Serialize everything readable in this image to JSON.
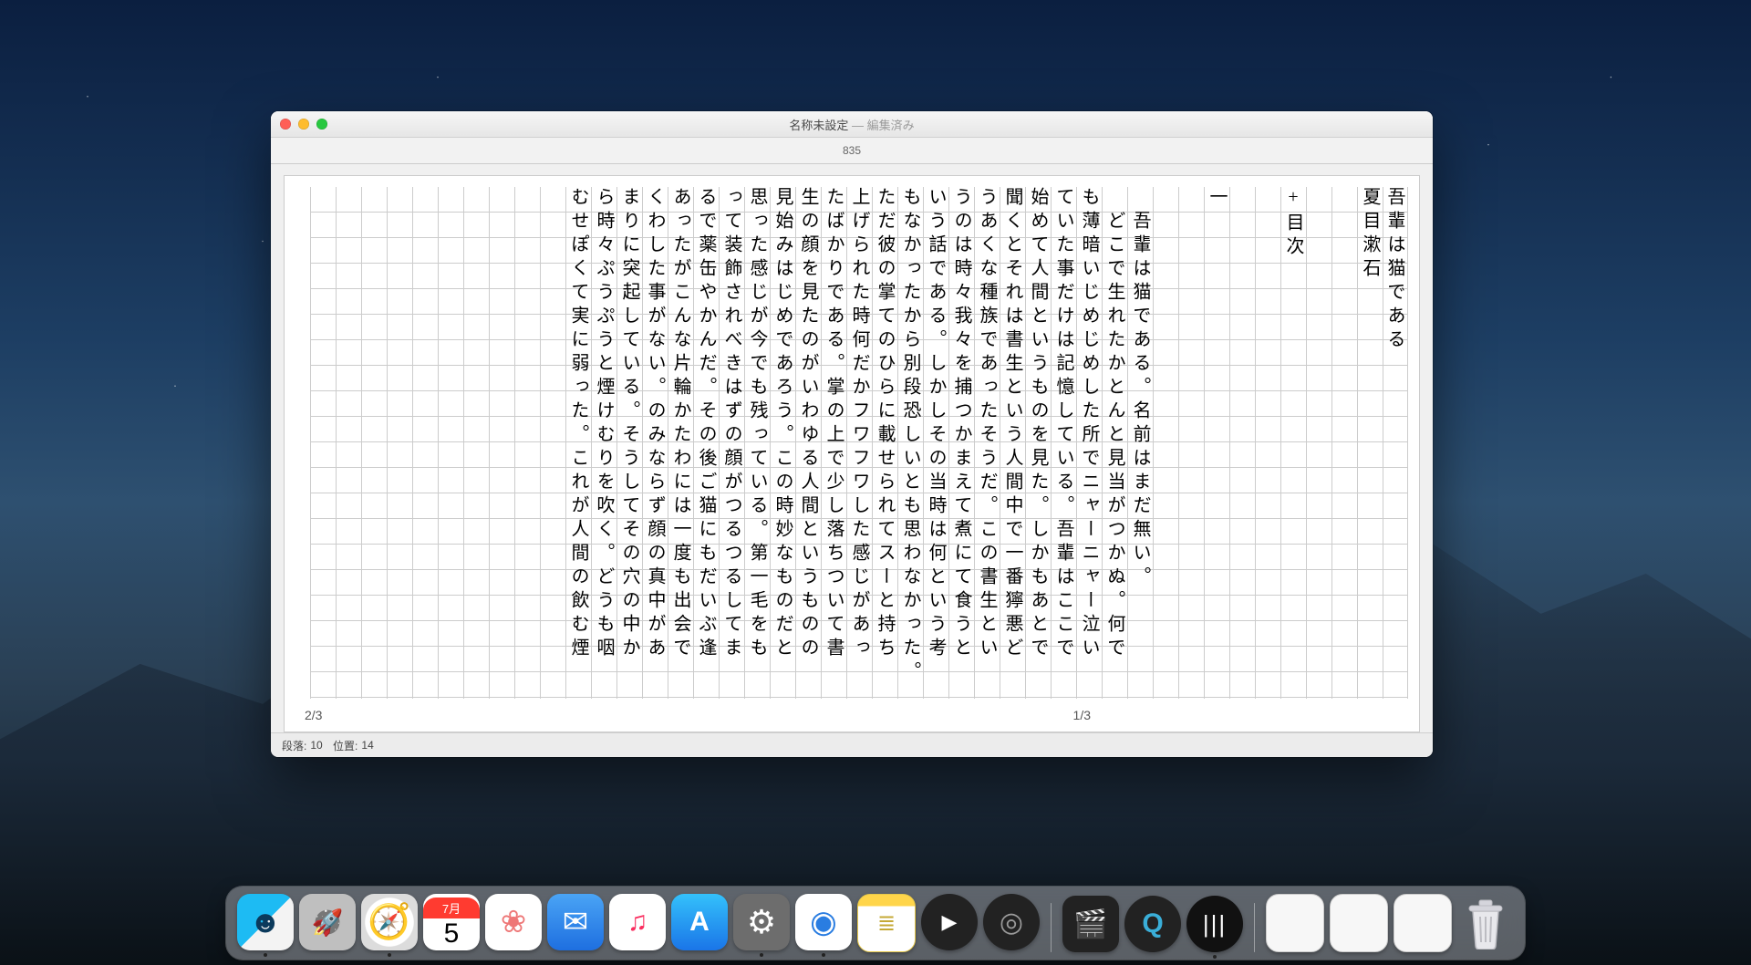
{
  "window": {
    "title": "名称未設定",
    "title_suffix": "— 編集済み",
    "ruler_value": "835",
    "page_left": "2/3",
    "page_right": "1/3"
  },
  "status": {
    "paragraph_label": "段落:",
    "paragraph_value": "10",
    "position_label": "位置:",
    "position_value": "14"
  },
  "columns": [
    "吾輩は猫である",
    "夏目漱石",
    "",
    "",
    "+目次",
    "",
    "",
    "一",
    "",
    "",
    "　吾輩は猫である。名前はまだ無い。",
    "　どこで生れたかとんと見当がつかぬ。何で",
    "も薄暗いじめじめした所でニャーニャー泣い",
    "ていた事だけは記憶している。吾輩はここで",
    "始めて人間というものを見た。しかもあとで",
    "聞くとそれは書生という人間中で一番獰悪ど",
    "うあくな種族であったそうだ。この書生とい",
    "うのは時々我々を捕つかまえて煮にて食うと",
    "いう話である。しかしその当時は何という考",
    "もなかったから別段恐しいとも思わなかった。",
    "ただ彼の掌てのひらに載せられてスーと持ち",
    "上げられた時何だかフワフワした感じがあっ",
    "たばかりである。掌の上で少し落ちついて書",
    "生の顔を見たのがいわゆる人間というものの",
    "見始みはじめであろう。この時妙なものだと",
    "思った感じが今でも残っている。第一毛をも",
    "って装飾されべきはずの顔がつるつるしてま",
    "るで薬缶やかんだ。その後ご猫にもだいぶ逢",
    "あったがこんな片輪かたわには一度も出会で",
    "くわした事がない。のみならず顔の真中があ",
    "まりに突起している。そうしてその穴の中か",
    "ら時々ぷうぷうと煙けむりを吹く。どうも咽",
    "むせぽくて実に弱った。これが人間の飲む煙"
  ],
  "dock": {
    "calendar_month": "7月",
    "calendar_day": "5",
    "items": [
      {
        "name": "finder",
        "running": true
      },
      {
        "name": "launchpad",
        "running": false
      },
      {
        "name": "safari",
        "running": true
      },
      {
        "name": "calendar",
        "running": false
      },
      {
        "name": "photos",
        "running": false
      },
      {
        "name": "mail",
        "running": false
      },
      {
        "name": "music",
        "running": false
      },
      {
        "name": "appstore",
        "running": false
      },
      {
        "name": "prefs",
        "running": true
      },
      {
        "name": "chrome",
        "running": true
      },
      {
        "name": "notes",
        "running": false
      },
      {
        "name": "media1",
        "running": false
      },
      {
        "name": "media2",
        "running": false
      }
    ],
    "items2": [
      {
        "name": "fcp",
        "running": false
      },
      {
        "name": "qt",
        "running": false
      },
      {
        "name": "stripes",
        "running": true
      }
    ],
    "minis": [
      {
        "name": "min1"
      },
      {
        "name": "min2"
      },
      {
        "name": "min3"
      }
    ]
  }
}
